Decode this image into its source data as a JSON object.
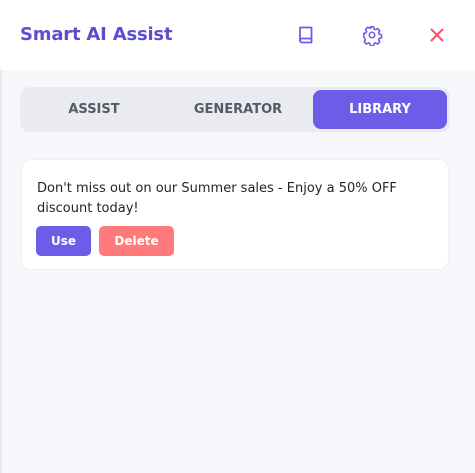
{
  "app": {
    "title": "Smart AI Assist"
  },
  "header_icons": {
    "library": "book-icon",
    "settings": "gear-icon",
    "close": "close-icon"
  },
  "colors": {
    "accent": "#6d5ce8",
    "title": "#5b4fcf",
    "danger": "#ff7b7b",
    "close": "#ff4d6d"
  },
  "tabs": [
    {
      "label": "ASSIST",
      "active": false
    },
    {
      "label": "GENERATOR",
      "active": false
    },
    {
      "label": "LIBRARY",
      "active": true
    }
  ],
  "library": {
    "items": [
      {
        "text": "Don't miss out on our Summer sales - Enjoy a 50% OFF discount today!",
        "use_label": "Use",
        "delete_label": "Delete"
      }
    ]
  }
}
